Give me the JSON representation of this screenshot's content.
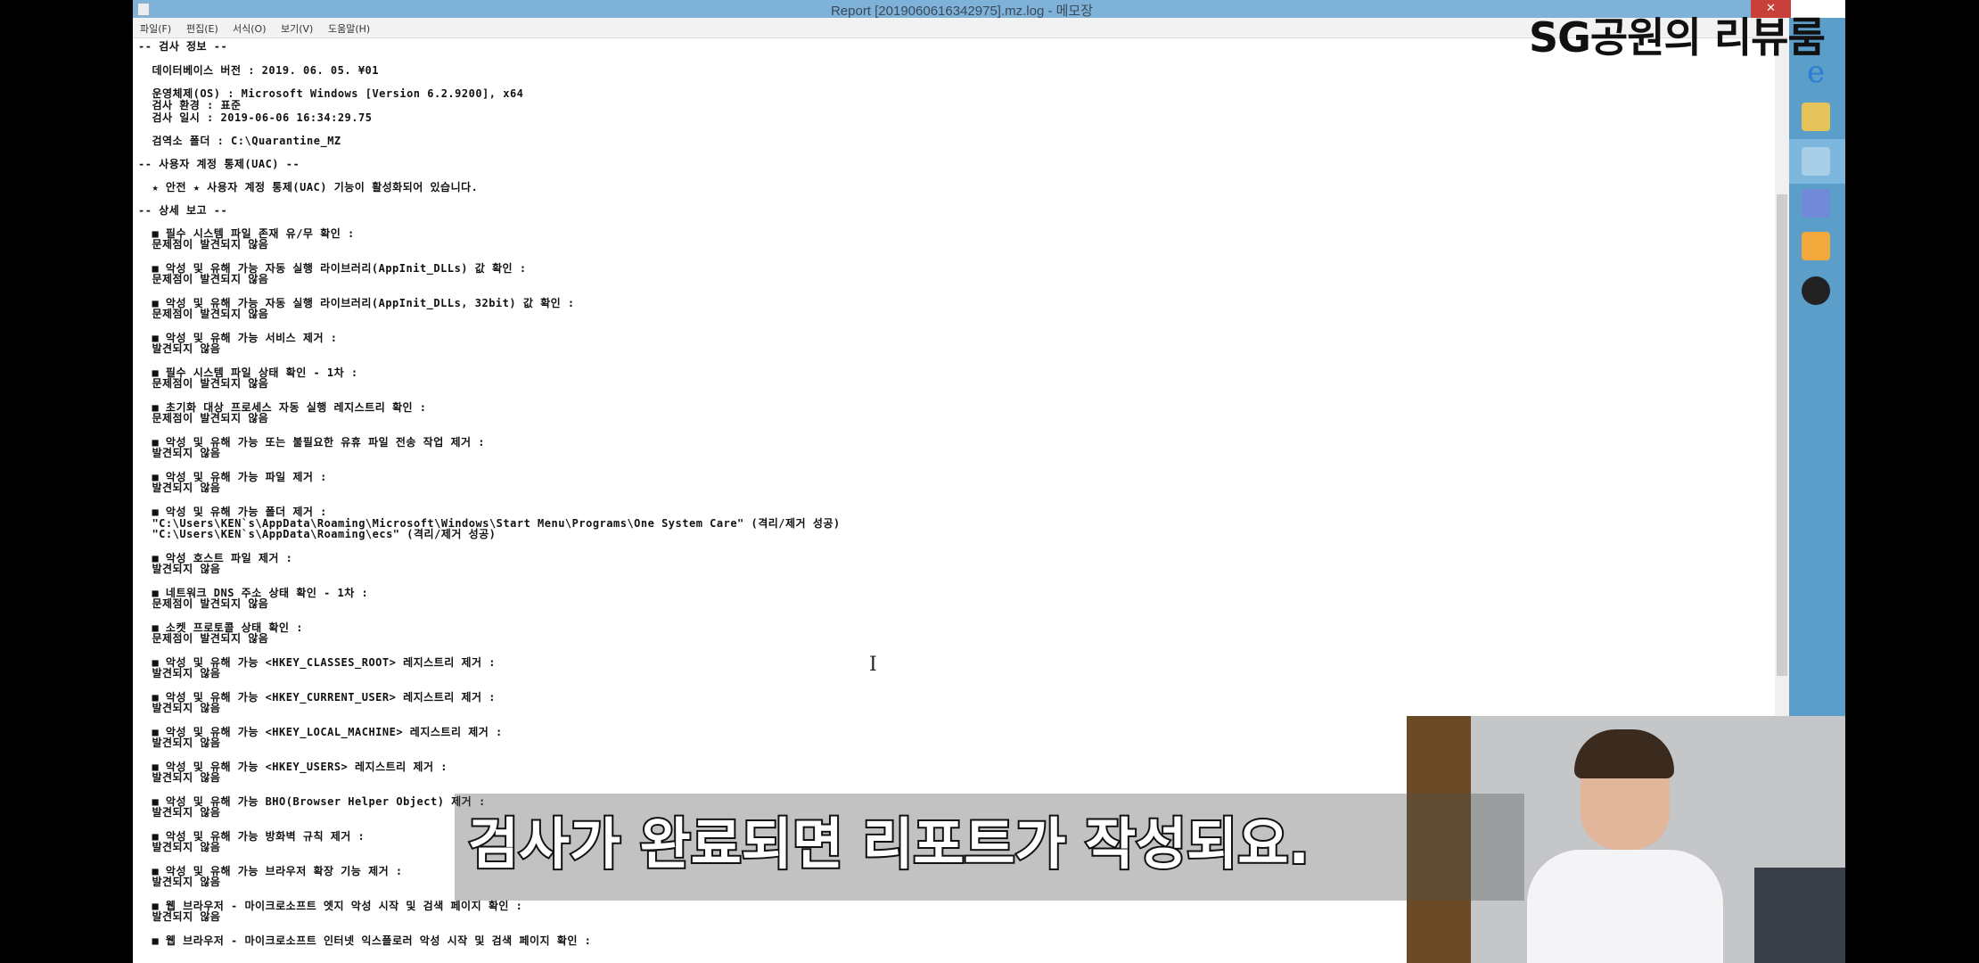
{
  "window": {
    "title": "Report [20190606163429​75].mz.log - 메모장",
    "close": "✕"
  },
  "menu": [
    "파일(F)",
    "편집(E)",
    "서식(O)",
    "보기(V)",
    "도움말(H)"
  ],
  "log_lines": [
    "-- 검사 정보 --",
    "  데이터베이스 버전 : 2019. 06. 05. ¥01",
    "  운영체제(OS) : Microsoft Windows [Version 6.2.9200], x64",
    "  검사 환경 : 표준",
    "  검사 일시 : 2019-06-06 16:34:29.75",
    "  검역소 폴더 : C:\\Quarantine_MZ",
    "-- 사용자 계정 통제(UAC) --",
    "  ★ 안전 ★ 사용자 계정 통제(UAC) 기능이 활성화되어 있습니다.",
    "-- 상세 보고 --",
    "  ■ 필수 시스템 파일 존재 유/무 확인 :",
    "  문제점이 발견되지 않음",
    "  ■ 악성 및 유해 가능 자동 실행 라이브러리(AppInit_DLLs) 값 확인 :",
    "  문제점이 발견되지 않음",
    "  ■ 악성 및 유해 가능 자동 실행 라이브러리(AppInit_DLLs, 32bit) 값 확인 :",
    "  문제점이 발견되지 않음",
    "  ■ 악성 및 유해 가능 서비스 제거 :",
    "  발견되지 않음",
    "  ■ 필수 시스템 파일 상태 확인 - 1차 :",
    "  문제점이 발견되지 않음",
    "  ■ 초기화 대상 프로세스 자동 실행 레지스트리 확인 :",
    "  문제점이 발견되지 않음",
    "  ■ 악성 및 유해 가능 또는 불필요한 유휴 파일 전송 작업 제거 :",
    "  발견되지 않음",
    "  ■ 악성 및 유해 가능 파일 제거 :",
    "  발견되지 않음",
    "  ■ 악성 및 유해 가능 폴더 제거 :",
    "  \"C:\\Users\\KEN`s\\AppData\\Roaming\\Microsoft\\Windows\\Start Menu\\Programs\\One System Care\" (격리/제거 성공)",
    "  \"C:\\Users\\KEN`s\\AppData\\Roaming\\ecs\" (격리/제거 성공)",
    "  ■ 악성 호스트 파일 제거 :",
    "  발견되지 않음",
    "  ■ 네트워크 DNS 주소 상태 확인 - 1차 :",
    "  문제점이 발견되지 않음",
    "  ■ 소켓 프로토콜 상태 확인 :",
    "  문제점이 발견되지 않음",
    "  ■ 악성 및 유해 가능 <HKEY_CLASSES_ROOT> 레지스트리 제거 :",
    "  발견되지 않음",
    "  ■ 악성 및 유해 가능 <HKEY_CURRENT_USER> 레지스트리 제거 :",
    "  발견되지 않음",
    "  ■ 악성 및 유해 가능 <HKEY_LOCAL_MACHINE> 레지스트리 제거 :",
    "  발견되지 않음",
    "  ■ 악성 및 유해 가능 <HKEY_USERS> 레지스트리 제거 :",
    "  발견되지 않음",
    "  ■ 악성 및 유해 가능 BHO(Browser Helper Object) 제거 :",
    "  발견되지 않음",
    "  ■ 악성 및 유해 가능 방화벽 규칙 제거 :",
    "  발견되지 않음",
    "  ■ 악성 및 유해 가능 브라우저 확장 기능 제거 :",
    "  발견되지 않음",
    "  ■ 웹 브라우저 - 마이크로소프트 엣지 악성 시작 및 검색 페이지 확인 :",
    "  발견되지 않음",
    "  ■ 웹 브라우저 - 마이크로소프트 인터넷 익스플로러 악성 시작 및 검색 페이지 확인 :"
  ],
  "overlay": {
    "channel_logo": "SG공원의 리뷰룸",
    "subtitle": "검사가 완료되면 리포트가 작성되요."
  },
  "taskbar_icons": [
    "internet-explorer-icon",
    "folder-icon",
    "notepad-icon",
    "discord-icon",
    "kakaotalk-icon",
    "obs-icon"
  ]
}
